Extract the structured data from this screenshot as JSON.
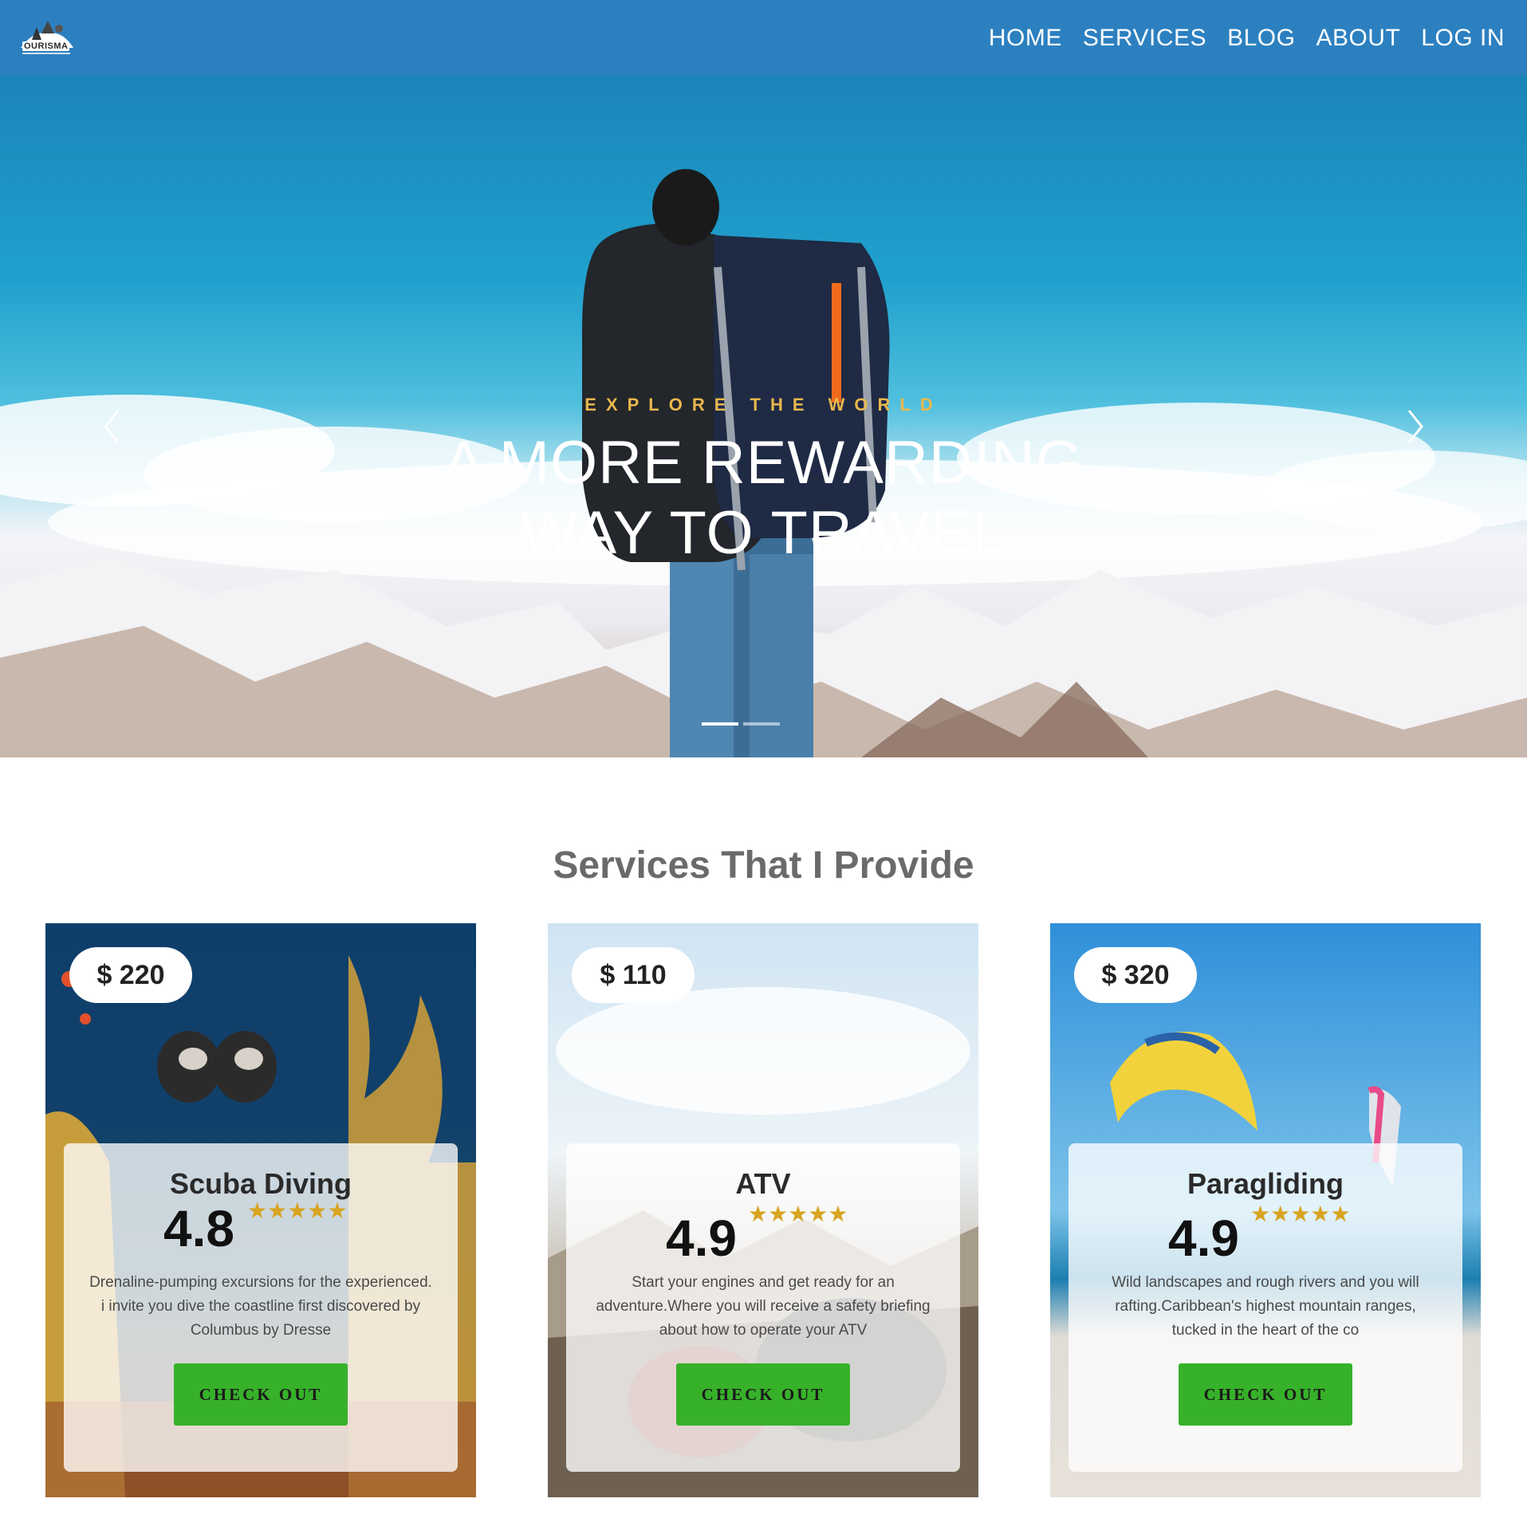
{
  "navbar": {
    "logo_text": "OURISMA",
    "links": [
      "HOME",
      "SERVICES",
      "BLOG",
      "ABOUT",
      "LOG IN"
    ]
  },
  "hero": {
    "kicker": "EXPLORE THE WORLD",
    "title_line1": "A MORE REWARDING",
    "title_line2": "WAY TO TRAVEL",
    "slides": 2,
    "active_slide": 0
  },
  "services": {
    "title": "Services That I Provide",
    "cards": [
      {
        "price": "$ 220",
        "name": "Scuba Diving",
        "rating": "4.8",
        "stars": 5,
        "description": "Drenaline-pumping excursions for the experienced. i invite you dive the coastline first discovered by Columbus by Dresse",
        "button": "CHECK OUT"
      },
      {
        "price": "$ 110",
        "name": "ATV",
        "rating": "4.9",
        "stars": 5,
        "description": "Start your engines and get ready for an adventure.Where you will receive a safety briefing about how to operate your ATV",
        "button": "CHECK OUT"
      },
      {
        "price": "$ 320",
        "name": "Paragliding",
        "rating": "4.9",
        "stars": 5,
        "description": "Wild landscapes and rough rivers and you will rafting.Caribbean's highest mountain ranges, tucked in the heart of the co",
        "button": "CHECK OUT"
      }
    ]
  },
  "colors": {
    "navbar": "#2c80c0",
    "kicker": "#e8b74c",
    "button": "#37b12a",
    "stars": "#d8a421"
  }
}
